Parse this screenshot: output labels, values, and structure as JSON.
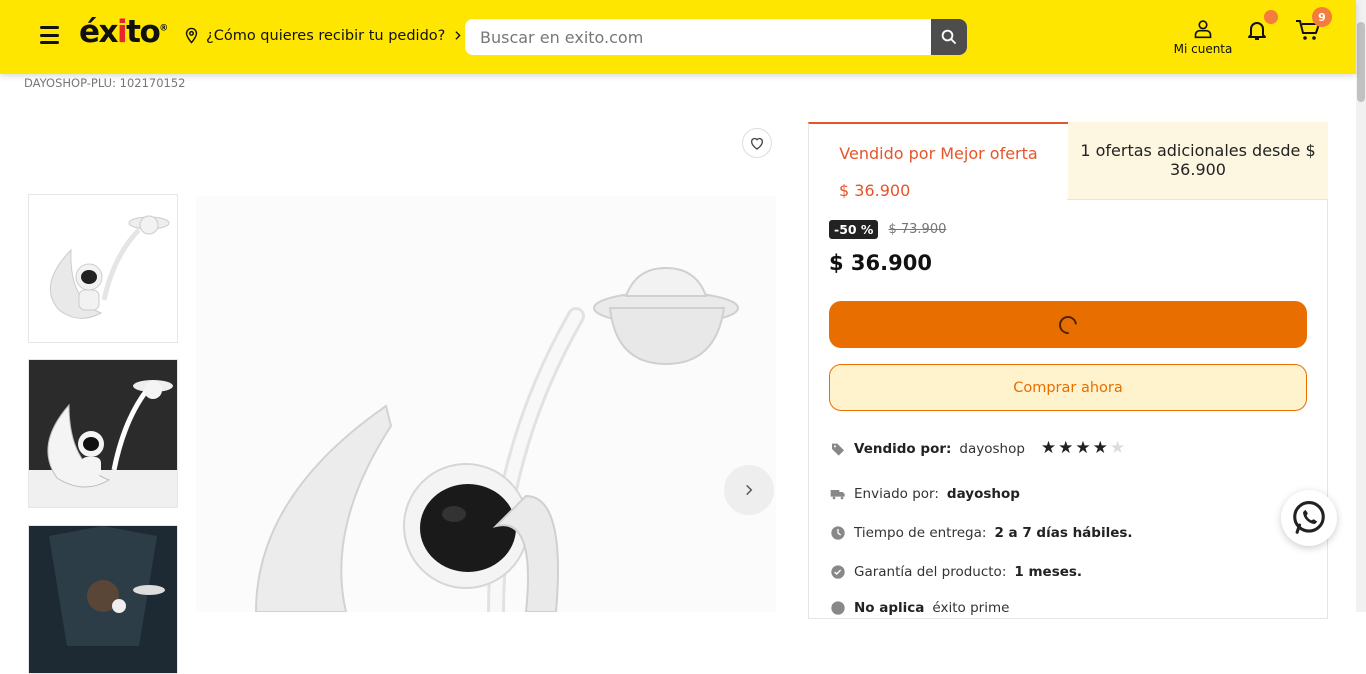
{
  "header": {
    "logo": "éxito",
    "location_label": "¿Cómo quieres recibir tu pedido?",
    "search_placeholder": "Buscar en exito.com",
    "account_label": "Mi cuenta",
    "cart_count": "9"
  },
  "breadcrumb": {
    "plu": "DAYOSHOP-PLU: 102170152"
  },
  "seller_tabs": {
    "active": {
      "title": "Vendido por Mejor oferta",
      "price": "$ 36.900"
    },
    "other": {
      "title": "1 ofertas adicionales desde $ 36.900"
    }
  },
  "pricing": {
    "discount": "-50 %",
    "old_price": "$ 73.900",
    "price": "$ 36.900"
  },
  "actions": {
    "buy_now": "Comprar ahora"
  },
  "details": {
    "sold_by_label": "Vendido por:",
    "sold_by": "dayoshop",
    "seller_rating": 4,
    "seller_rating_max": 5,
    "shipped_by_label": "Enviado por:",
    "shipped_by": "dayoshop",
    "delivery_label": "Tiempo de entrega:",
    "delivery": "2 a 7 días hábiles.",
    "warranty_label": "Garantía del producto:",
    "warranty": "1 meses.",
    "prime_label": "No aplica",
    "prime": "éxito prime"
  },
  "colors": {
    "brand_yellow": "#ffe600",
    "accent_orange": "#e86e00",
    "tab_accent": "#e5552a"
  }
}
